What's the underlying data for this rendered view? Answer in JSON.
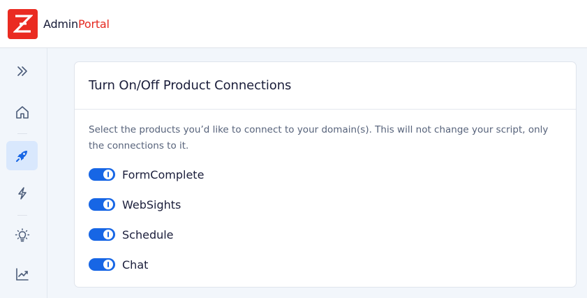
{
  "app": {
    "brand_part1": "Admin",
    "brand_part2": "Portal",
    "logo_letter": "Z"
  },
  "colors": {
    "brand_red": "#ea2b21",
    "accent_blue": "#1766e5",
    "sidebar_bg": "#f2f6fb",
    "active_bg": "#d9e8fd"
  },
  "sidebar": {
    "items": [
      {
        "icon": "expand-chevrons-icon",
        "active": false
      },
      {
        "icon": "home-icon",
        "active": false
      },
      {
        "icon": "rocket-icon",
        "active": true
      },
      {
        "icon": "lightning-icon",
        "active": false
      },
      {
        "icon": "lightbulb-icon",
        "active": false
      },
      {
        "icon": "trend-chart-icon",
        "active": false
      }
    ]
  },
  "card": {
    "title": "Turn On/Off Product Connections",
    "description": "Select the products you’d like to connect to your domain(s). This will not change your script, only the connections to it.",
    "products": [
      {
        "label": "FormComplete",
        "enabled": true
      },
      {
        "label": "WebSights",
        "enabled": true
      },
      {
        "label": "Schedule",
        "enabled": true
      },
      {
        "label": "Chat",
        "enabled": true
      }
    ]
  }
}
